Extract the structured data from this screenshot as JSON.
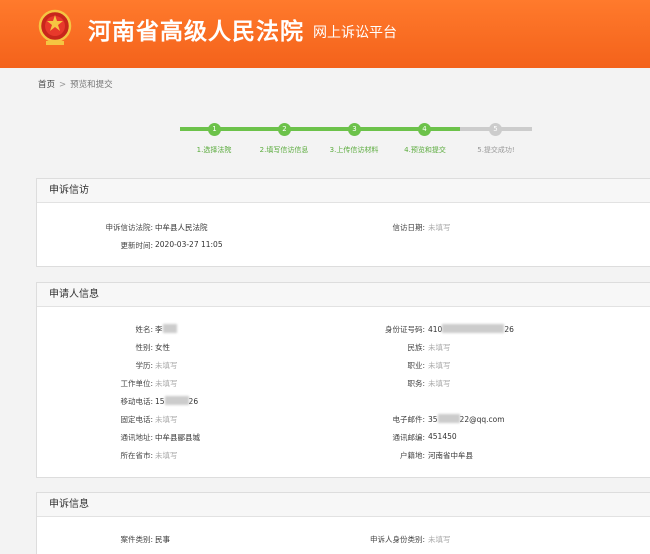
{
  "header": {
    "court_name": "河南省高级人民法院",
    "platform": "网上诉讼平台",
    "brand_color": "#f4621b"
  },
  "breadcrumb": {
    "home": "首页",
    "separator": ">",
    "current": "预览和提交"
  },
  "steps": {
    "active_color": "#6cc24a",
    "inactive_color": "#cccccc",
    "items": [
      {
        "num": "1",
        "label": "1.选择法院",
        "done": true
      },
      {
        "num": "2",
        "label": "2.填写信访信息",
        "done": true
      },
      {
        "num": "3",
        "label": "3.上传信访材料",
        "done": true
      },
      {
        "num": "4",
        "label": "4.预览和提交",
        "done": true
      },
      {
        "num": "5",
        "label": "5.提交成功!",
        "done": false
      }
    ]
  },
  "petition_panel": {
    "title": "申诉信访",
    "court_label": "申诉信访法院:",
    "court_value": "中牟县人民法院",
    "date_label": "信访日期:",
    "date_value": "未填写",
    "updated_label": "更新时间:",
    "updated_value": "2020-03-27 11:05"
  },
  "applicant_panel": {
    "title": "申请人信息",
    "name_label": "姓名:",
    "name_value": "李",
    "id_label": "身份证号码:",
    "id_prefix": "410",
    "id_suffix": "26",
    "gender_label": "性别:",
    "gender_value": "女性",
    "ethnicity_label": "民族:",
    "ethnicity_value": "未填写",
    "education_label": "学历:",
    "education_value": "未填写",
    "job_label": "职业:",
    "job_value": "未填写",
    "work_label": "工作单位:",
    "work_value": "未填写",
    "position_label": "职务:",
    "position_value": "未填写",
    "mobile_label": "移动电话:",
    "mobile_prefix": "15",
    "mobile_suffix": "26",
    "phone_label": "固定电话:",
    "phone_value": "未填写",
    "email_label": "电子邮件:",
    "email_prefix": "35",
    "email_suffix": "22@qq.com",
    "address_label": "通讯地址:",
    "address_value": "中牟县郦县城",
    "zip_label": "通讯邮编:",
    "zip_value": "451450",
    "province_label": "所在省市:",
    "province_value": "未填写",
    "hukou_label": "户籍地:",
    "hukou_value": "河南省中牟县"
  },
  "appeal_panel": {
    "title": "申诉信息",
    "case_type_label": "案件类别:",
    "case_type_value": "民事",
    "identity_label": "申诉人身份类别:",
    "identity_value": "未填写"
  }
}
